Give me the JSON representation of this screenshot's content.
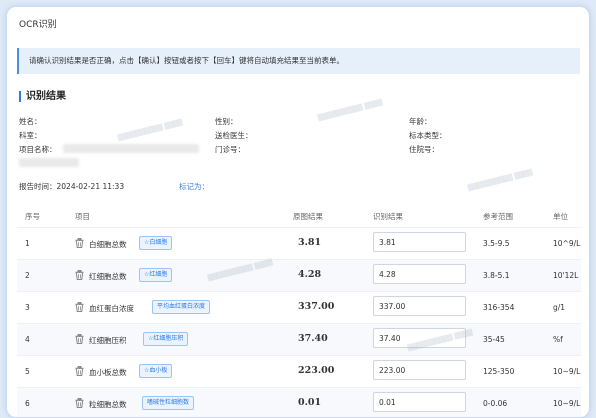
{
  "window": {
    "title": "OCR识别"
  },
  "hint": "请确认识别结果是否正确，点击【确认】按钮或者按下【回车】键将自动填充结果至当前表单。",
  "section_title": "识别结果",
  "patient": {
    "name_label": "姓名：",
    "gender_label": "性别：",
    "age_label": "年龄：",
    "dept_label": "科室：",
    "doctor_label": "送检医生：",
    "specimen_label": "标本类型：",
    "item_label": "项目名称：",
    "clinic_label": "门诊号：",
    "inpatient_label": "住院号："
  },
  "report": {
    "time_label": "报告时间：",
    "time_value": "2024-02-21 11:33",
    "marked_label": "标记为："
  },
  "table": {
    "headers": [
      "序号",
      "项目",
      "原图结果",
      "识别结果",
      "参考范围",
      "单位"
    ],
    "rows": [
      {
        "no": "1",
        "name": "白细胞总数",
        "tag": "☆白细胞",
        "orig": "3.81",
        "value": "3.81",
        "range": "3.5-9.5",
        "unit": "10^9/L"
      },
      {
        "no": "2",
        "name": "红细胞总数",
        "tag": "☆红细胞",
        "orig": "4.28",
        "value": "4.28",
        "range": "3.8-5.1",
        "unit": "10'12L"
      },
      {
        "no": "3",
        "name": "血红蛋白浓度",
        "tag": "平均血红蛋白浓度",
        "orig": "337.00",
        "value": "337.00",
        "range": "316-354",
        "unit": "g/1"
      },
      {
        "no": "4",
        "name": "红细胞压积",
        "tag": "☆红细胞压积",
        "orig": "37.40",
        "value": "37.40",
        "range": "35-45",
        "unit": "%f"
      },
      {
        "no": "5",
        "name": "血小板总数",
        "tag": "☆血小板",
        "orig": "223.00",
        "value": "223.00",
        "range": "125-350",
        "unit": "10~9/L"
      },
      {
        "no": "6",
        "name": "粒细胞总数",
        "tag": "嗜碱性粒细胞数",
        "orig": "0.01",
        "value": "0.01",
        "range": "0-0.06",
        "unit": "10~9/L"
      }
    ]
  }
}
